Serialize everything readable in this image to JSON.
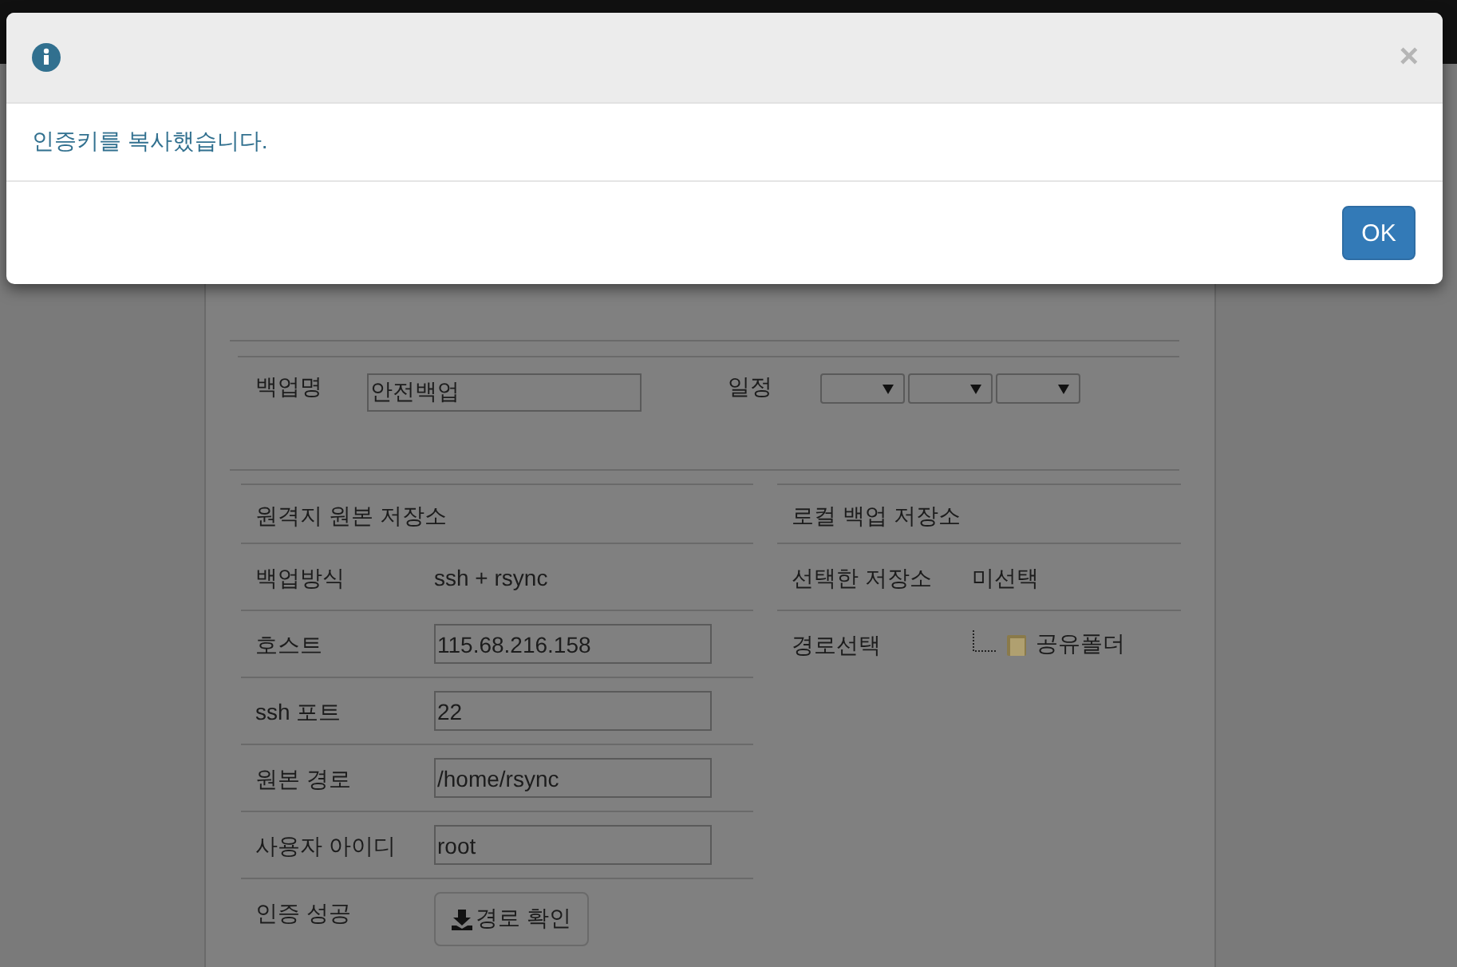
{
  "dialog": {
    "close": "×",
    "message": "인증키를 복사했습니다.",
    "button": "OK"
  },
  "backup": {
    "name_label": "백업명",
    "name_value": "안전백업",
    "schedule_label": "일정"
  },
  "remote": {
    "title": "원격지 원본 저장소",
    "rows": [
      {
        "label": "백업방식",
        "kind": "text",
        "value": "ssh + rsync"
      },
      {
        "label": "호스트",
        "kind": "input",
        "value": "115.68.216.158"
      },
      {
        "label": "ssh 포트",
        "kind": "input",
        "value": "22"
      },
      {
        "label": "원본 경로",
        "kind": "input",
        "value": "/home/rsync"
      },
      {
        "label": "사용자 아이디",
        "kind": "input",
        "value": "root"
      },
      {
        "label": "인증 성공",
        "kind": "button",
        "value": "경로 확인"
      }
    ]
  },
  "local": {
    "title": "로컬 백업 저장소",
    "rows": [
      {
        "label": "선택한 저장소",
        "kind": "text",
        "value": "미선택"
      },
      {
        "label": "경로선택",
        "kind": "tree",
        "value": "공유폴더"
      }
    ]
  }
}
